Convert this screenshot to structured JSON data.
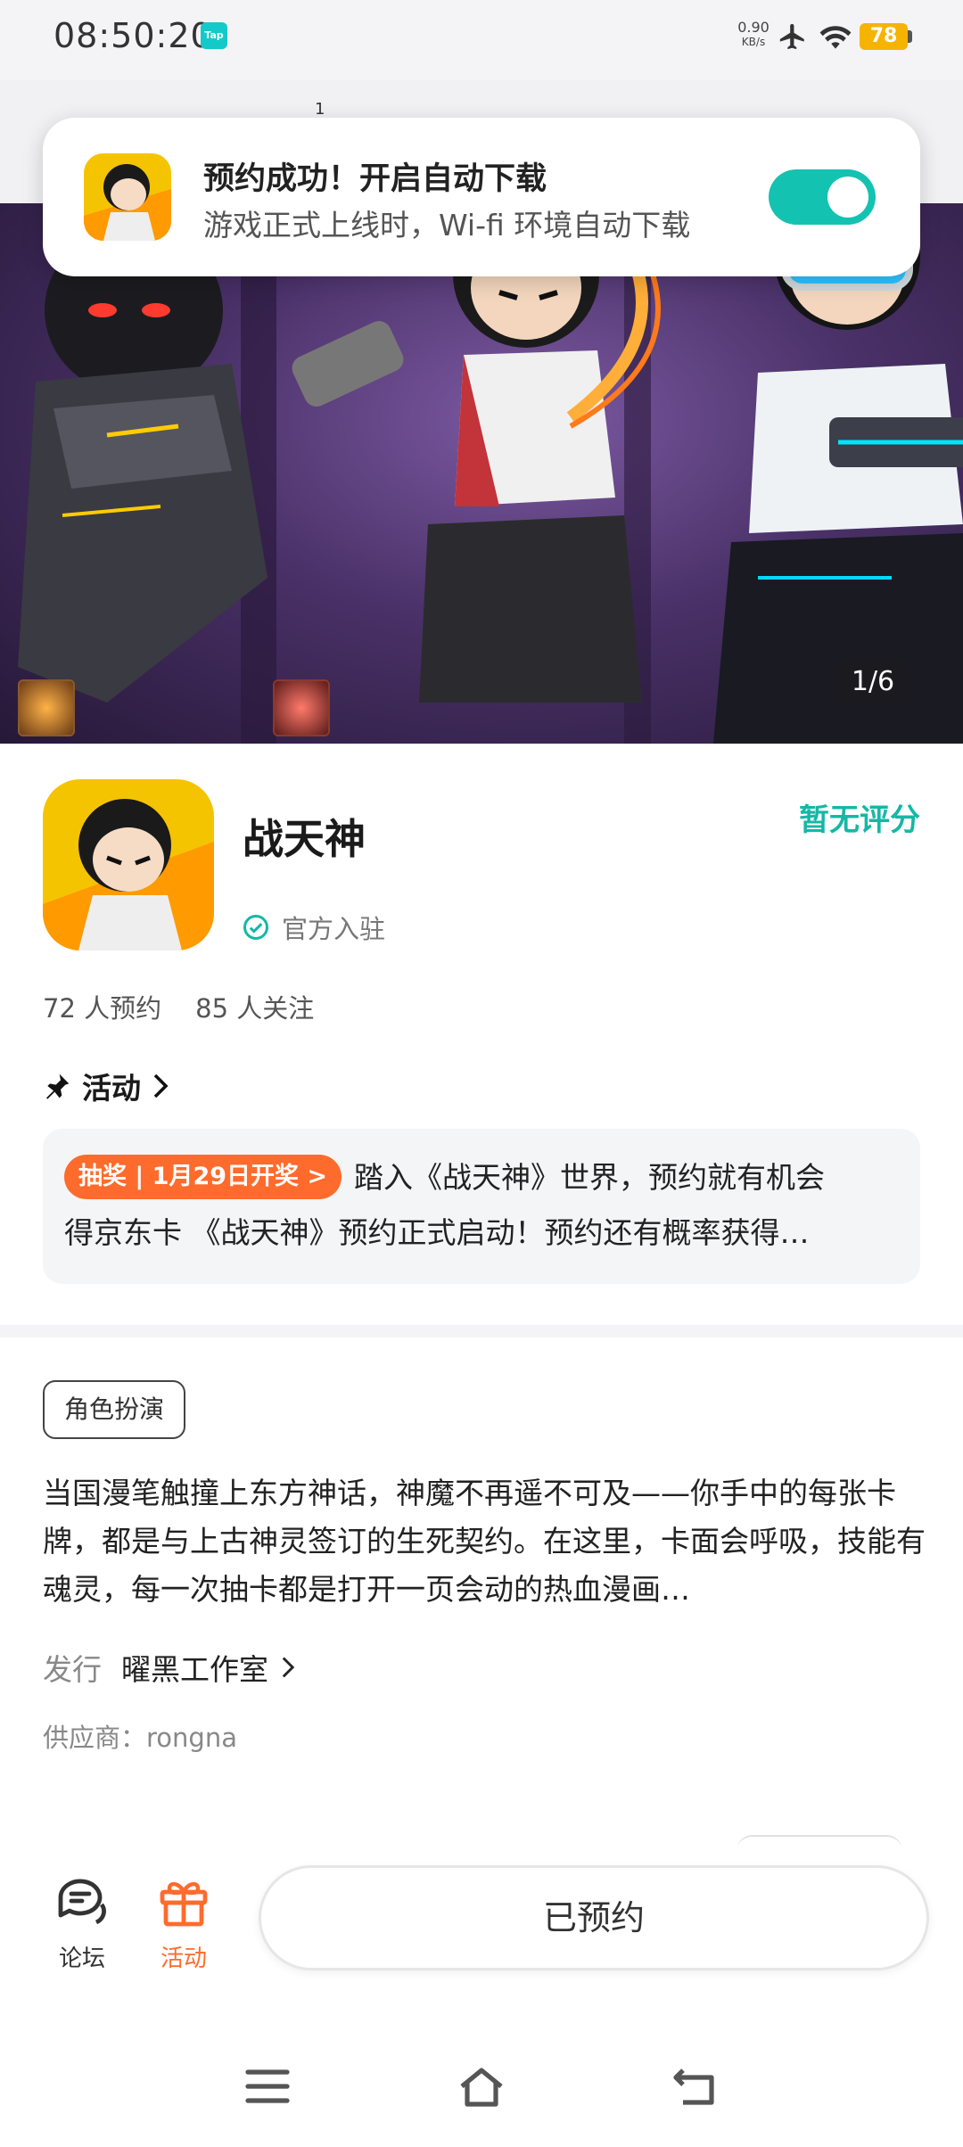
{
  "status_bar": {
    "time": "08:50:20",
    "app_badge": "Tap",
    "net_speed_value": "0.90",
    "net_speed_unit": "KB/s",
    "battery": "78"
  },
  "strip_number": "1",
  "toast": {
    "title": "预约成功！开启自动下载",
    "subtitle": "游戏正式上线时，Wi-fi 环境自动下载",
    "toggle_on": true
  },
  "banner": {
    "page_indicator": "1/6"
  },
  "game": {
    "name": "战天神",
    "official_label": "官方入驻",
    "rating": "暂无评分",
    "reservations": "72 人预约",
    "followers": "85 人关注"
  },
  "activity": {
    "title": "活动",
    "tag": "抽奖 | 1月29日开奖 >",
    "line1": "踏入《战天神》世界，预约就有机会",
    "line2": "得京东卡 《战天神》预约正式启动！预约还有概率获得…"
  },
  "genre": "角色扮演",
  "description": "当国漫笔触撞上东方神话，神魔不再遥不可及——你手中的每张卡牌，都是与上古神灵签订的生死契约。在这里，卡面会呼吸，技能有魂灵，每一次抽卡都是打开一页会动的热血漫画…",
  "publisher": {
    "label": "发行",
    "name": "曜黑工作室"
  },
  "supplier": "供应商：rongna",
  "bottom_bar": {
    "forum_label": "论坛",
    "activity_label": "活动",
    "reserved_label": "已预约"
  },
  "colors": {
    "accent_teal": "#14c2b1",
    "activity_orange": "#ff6b2c",
    "battery_yellow": "#f6b400"
  },
  "icons": [
    "airplane-icon",
    "wifi-icon",
    "check-circle-icon",
    "pin-icon",
    "chevron-right-icon",
    "forum-icon",
    "gift-icon",
    "menu-icon",
    "home-icon",
    "back-icon"
  ]
}
